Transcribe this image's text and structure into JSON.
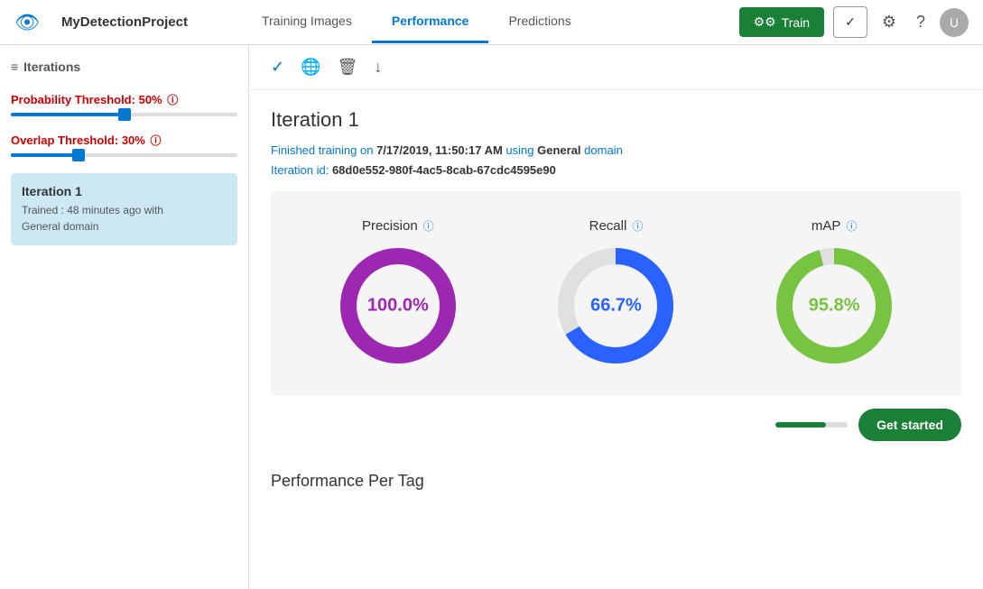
{
  "header": {
    "project_name": "MyDetectionProject",
    "nav": [
      {
        "id": "training-images",
        "label": "Training Images",
        "active": false
      },
      {
        "id": "performance",
        "label": "Performance",
        "active": true
      },
      {
        "id": "predictions",
        "label": "Predictions",
        "active": false
      }
    ],
    "btn_train_label": "Train",
    "btn_publish_label": "✓",
    "settings_icon": "⚙",
    "help_icon": "?",
    "avatar_label": "U"
  },
  "sidebar": {
    "section_title": "Iterations",
    "probability_threshold_label": "Probability Threshold:",
    "probability_threshold_value": "50%",
    "overlap_threshold_label": "Overlap Threshold:",
    "overlap_threshold_value": "30%",
    "probability_slider_pct": 50,
    "overlap_slider_pct": 30,
    "iteration": {
      "title": "Iteration 1",
      "trained_ago": "Trained : 48 minutes ago with",
      "domain": "General domain"
    }
  },
  "toolbar": {
    "check_icon": "✓",
    "globe_icon": "🌐",
    "trash_icon": "🗑",
    "download_icon": "↓"
  },
  "iteration_detail": {
    "title": "Iteration 1",
    "training_date": "7/17/2019, 11:50:17 AM",
    "domain": "General",
    "iteration_id": "68d0e552-980f-4ac5-8cab-67cdc4595e90",
    "meta_line1_prefix": "Finished training on ",
    "meta_line1_suffix": " using ",
    "meta_line1_domain_suffix": " domain",
    "meta_line2_prefix": "Iteration id: "
  },
  "metrics": {
    "precision": {
      "label": "Precision",
      "value": "100.0%",
      "color": "#9c27b0",
      "pct": 100
    },
    "recall": {
      "label": "Recall",
      "value": "66.7%",
      "color": "#2962ff",
      "pct": 66.7
    },
    "map": {
      "label": "mAP",
      "value": "95.8%",
      "color": "#76c442",
      "pct": 95.8
    }
  },
  "performance_per_tag": {
    "title": "Performance Per Tag"
  },
  "get_started": {
    "btn_label": "Get started"
  }
}
